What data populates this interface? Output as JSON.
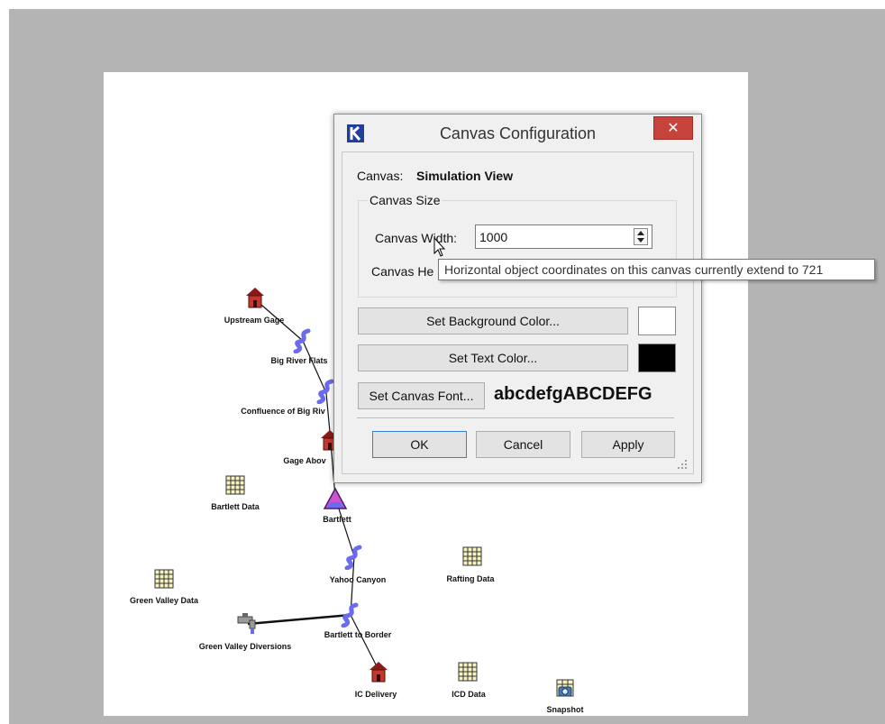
{
  "dialog": {
    "title": "Canvas Configuration",
    "close_glyph": "✕",
    "canvas_label": "Canvas:",
    "canvas_name": "Simulation View",
    "canvas_size_group": "Canvas Size",
    "width_label": "Canvas Width:",
    "width_value": "1000",
    "height_label": "Canvas He",
    "set_background_color": "Set Background Color...",
    "background_color": "#ffffff",
    "set_text_color": "Set Text Color...",
    "text_color": "#000000",
    "set_canvas_font": "Set Canvas Font...",
    "font_sample": "abcdefgABCDEFG",
    "ok": "OK",
    "cancel": "Cancel",
    "apply": "Apply"
  },
  "tooltip": "Horizontal object coordinates on this canvas currently extend to 721",
  "icons": {
    "app": "riverware-logo-icon",
    "cursor": "mouse-pointer-icon",
    "gage": "gage-house-icon",
    "reach": "reach-river-icon",
    "reservoir": "reservoir-triangle-icon",
    "data": "data-table-icon",
    "diversion": "diversion-faucet-icon",
    "snapshot": "snapshot-camera-icon"
  },
  "nodes": {
    "upstream_gage": "Upstream Gage",
    "big_river_flats": "Big River Flats",
    "confluence": "Confluence of Big Riv",
    "gage_above": "Gage Abov",
    "bartlett_data": "Bartlett Data",
    "bartlett": "Bartlett",
    "yahoo_canyon": "Yahoo Canyon",
    "rafting_data": "Rafting Data",
    "green_valley_data": "Green Valley Data",
    "green_valley_diversions": "Green Valley Diversions",
    "bartlett_to_border": "Bartlett to Border",
    "ic_delivery": "IC Delivery",
    "icd_data": "ICD Data",
    "snapshot": "Snapshot"
  },
  "colors": {
    "reach": "#6b6bf0",
    "gage_roof": "#8a1a1a",
    "gage_body": "#c0392b",
    "reservoir": "#cc55cc",
    "data_table": "#f6f3c0",
    "close_button": "#c7423a"
  }
}
